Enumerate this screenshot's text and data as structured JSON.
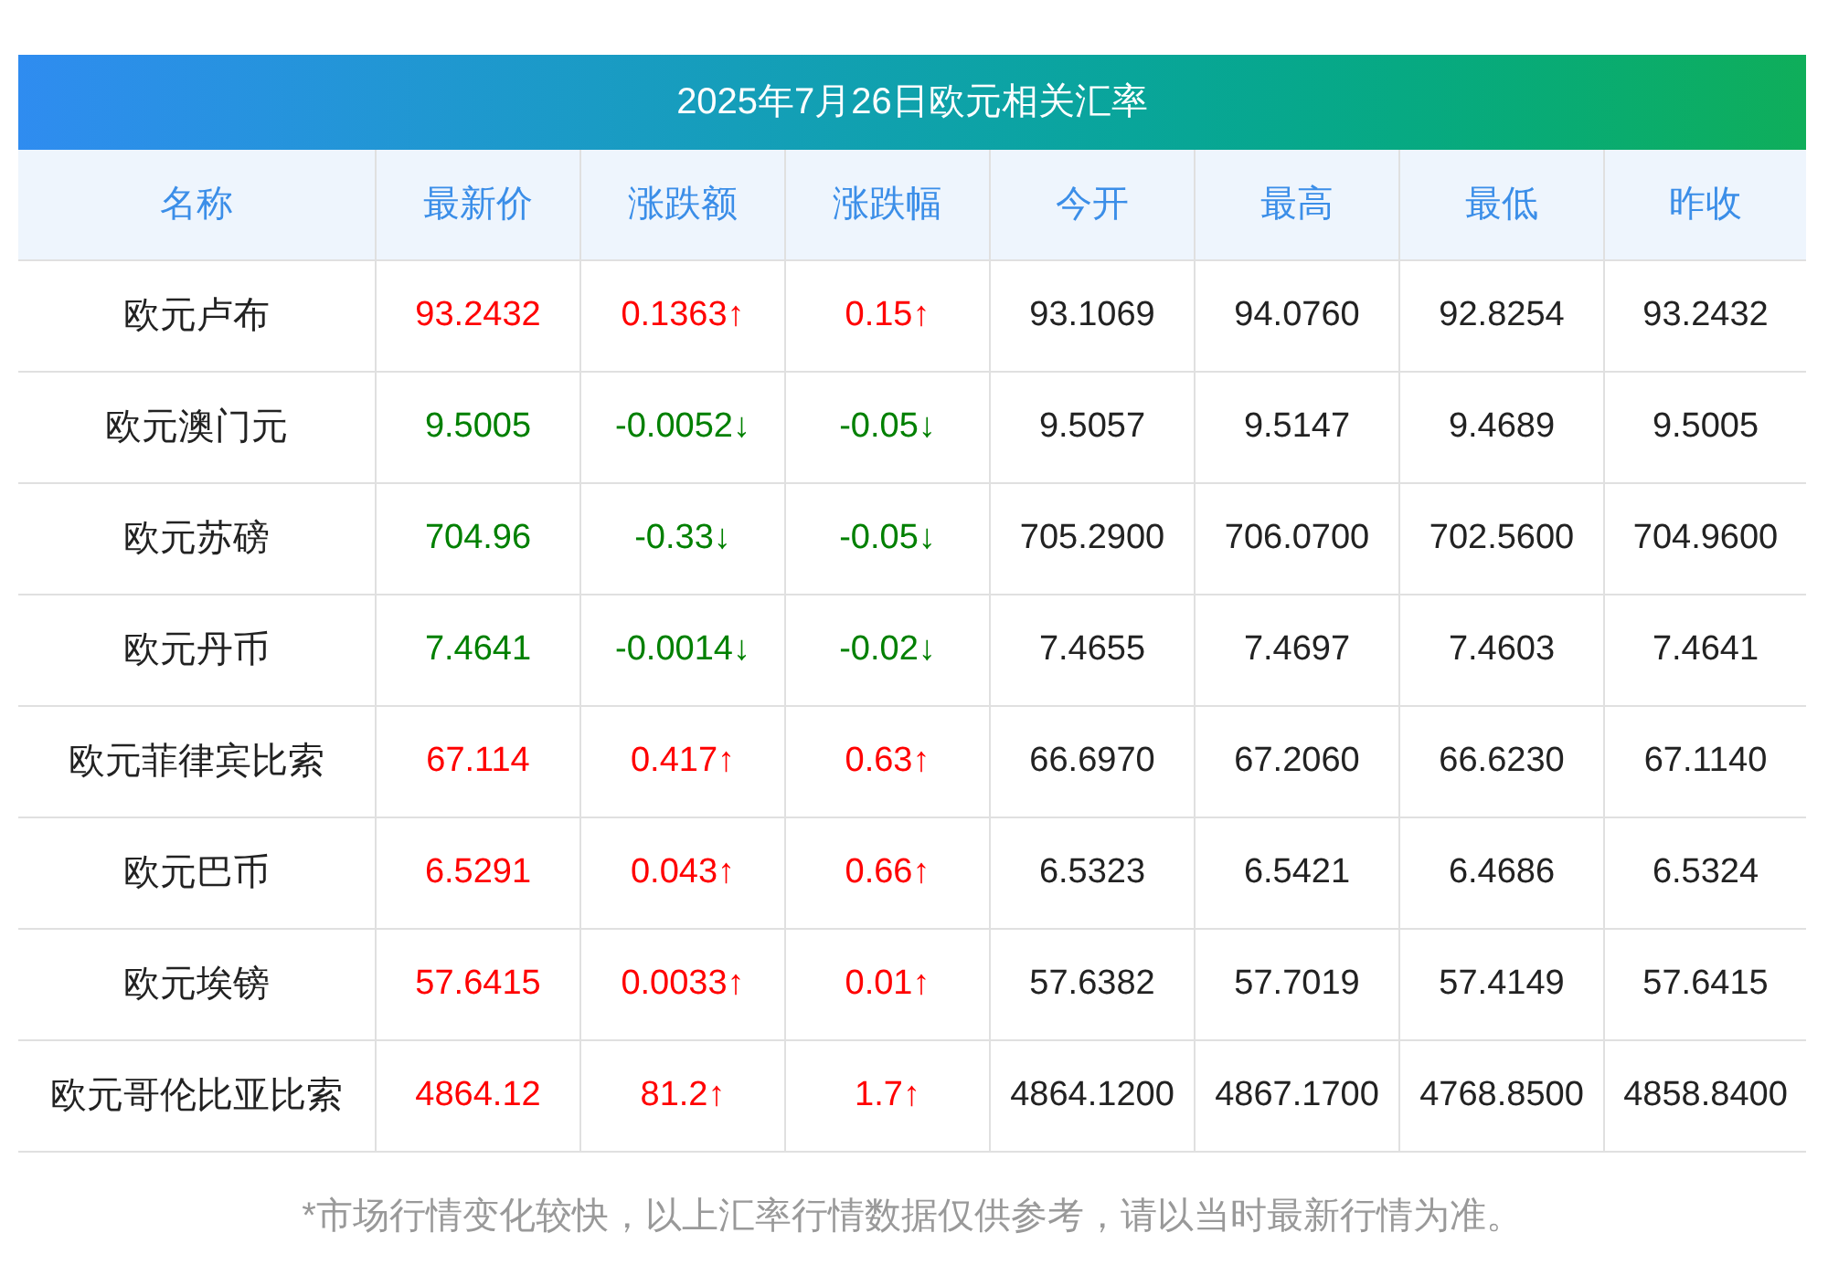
{
  "title": "2025年7月26日欧元相关汇率",
  "columns": [
    "名称",
    "最新价",
    "涨跌额",
    "涨跌幅",
    "今开",
    "最高",
    "最低",
    "昨收"
  ],
  "rows": [
    {
      "rising": true,
      "cells": [
        "欧元卢布",
        "93.2432",
        "0.1363↑",
        "0.15↑",
        "93.1069",
        "94.0760",
        "92.8254",
        "93.2432"
      ]
    },
    {
      "rising": false,
      "cells": [
        "欧元澳门元",
        "9.5005",
        "-0.0052↓",
        "-0.05↓",
        "9.5057",
        "9.5147",
        "9.4689",
        "9.5005"
      ]
    },
    {
      "rising": false,
      "cells": [
        "欧元苏磅",
        "704.96",
        "-0.33↓",
        "-0.05↓",
        "705.2900",
        "706.0700",
        "702.5600",
        "704.9600"
      ]
    },
    {
      "rising": false,
      "cells": [
        "欧元丹币",
        "7.4641",
        "-0.0014↓",
        "-0.02↓",
        "7.4655",
        "7.4697",
        "7.4603",
        "7.4641"
      ]
    },
    {
      "rising": true,
      "cells": [
        "欧元菲律宾比索",
        "67.114",
        "0.417↑",
        "0.63↑",
        "66.6970",
        "67.2060",
        "66.6230",
        "67.1140"
      ]
    },
    {
      "rising": true,
      "cells": [
        "欧元巴币",
        "6.5291",
        "0.043↑",
        "0.66↑",
        "6.5323",
        "6.5421",
        "6.4686",
        "6.5324"
      ]
    },
    {
      "rising": true,
      "cells": [
        "欧元埃镑",
        "57.6415",
        "0.0033↑",
        "0.01↑",
        "57.6382",
        "57.7019",
        "57.4149",
        "57.6415"
      ]
    },
    {
      "rising": true,
      "cells": [
        "欧元哥伦比亚比索",
        "4864.12",
        "81.2↑",
        "1.7↑",
        "4864.1200",
        "4867.1700",
        "4768.8500",
        "4858.8400"
      ]
    }
  ],
  "footnote": "*市场行情变化较快，以上汇率行情数据仅供参考，请以当时最新行情为准。"
}
